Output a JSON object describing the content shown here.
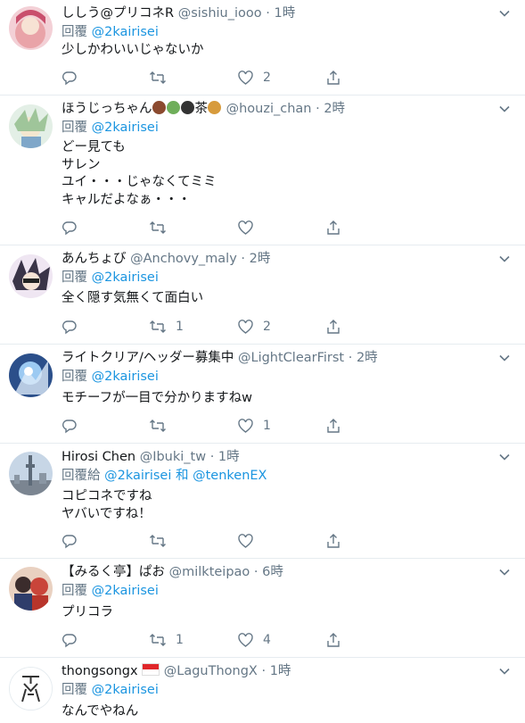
{
  "tweets": [
    {
      "name": "ししう@プリコネR",
      "handle": "@sishiu_iooo",
      "time": "1時",
      "reply_prefix": "回覆",
      "mention": "@2kairisei",
      "text": "少しかわいいじゃないか",
      "replies": "",
      "retweets": "",
      "likes": "2",
      "avatar_color": "#e9a3a8"
    },
    {
      "name": "ほうじっちゃん",
      "name_suffix": "茶",
      "handle": "@houzi_chan",
      "time": "2時",
      "reply_prefix": "回覆",
      "mention": "@2kairisei",
      "text": "どー見ても\nサレン\nユイ・・・じゃなくてミミ\nキャルだよなぁ・・・",
      "replies": "",
      "retweets": "",
      "likes": "",
      "avatar_color": "#cfe3c4"
    },
    {
      "name": "あんちょび",
      "handle": "@Anchovy_maly",
      "time": "2時",
      "reply_prefix": "回覆",
      "mention": "@2kairisei",
      "text": "全く隠す気無くて面白い",
      "replies": "",
      "retweets": "1",
      "likes": "2",
      "avatar_color": "#d7b9d9"
    },
    {
      "name": "ライトクリア/ヘッダー募集中",
      "handle": "@LightClearFirst",
      "time": "2時",
      "reply_prefix": "回覆",
      "mention": "@2kairisei",
      "text": "モチーフが一目で分かりますねw",
      "replies": "",
      "retweets": "",
      "likes": "1",
      "avatar_color": "#6c9fd3"
    },
    {
      "name": "Hirosi Chen",
      "handle": "@Ibuki_tw",
      "time": "1時",
      "reply_prefix": "回覆給",
      "mention": "@2kairisei",
      "reply_joiner": "和",
      "mention2": "@tenkenEX",
      "text": "コピコネですね\nヤバいですね！",
      "replies": "",
      "retweets": "",
      "likes": "",
      "avatar_color": "#a9b6c6"
    },
    {
      "name": "【みるく亭】ぱお",
      "handle": "@milkteipao",
      "time": "6時",
      "reply_prefix": "回覆",
      "mention": "@2kairisei",
      "text": "プリコラ",
      "replies": "",
      "retweets": "1",
      "likes": "4",
      "avatar_color": "#c9453a"
    },
    {
      "name": "thongsongx",
      "handle": "@LaguThongX",
      "time": "1時",
      "reply_prefix": "回覆",
      "mention": "@2kairisei",
      "text": "なんでやねん",
      "replies": "",
      "retweets": "",
      "likes": "",
      "avatar_color": "#ffffff"
    }
  ],
  "separator": "·",
  "colors": {
    "link": "#1b95e0",
    "muted": "#657786",
    "text": "#14171a",
    "border": "#e6ecf0"
  },
  "icons": [
    "reply-icon",
    "retweet-icon",
    "like-icon",
    "share-icon",
    "chevron-down-icon"
  ]
}
